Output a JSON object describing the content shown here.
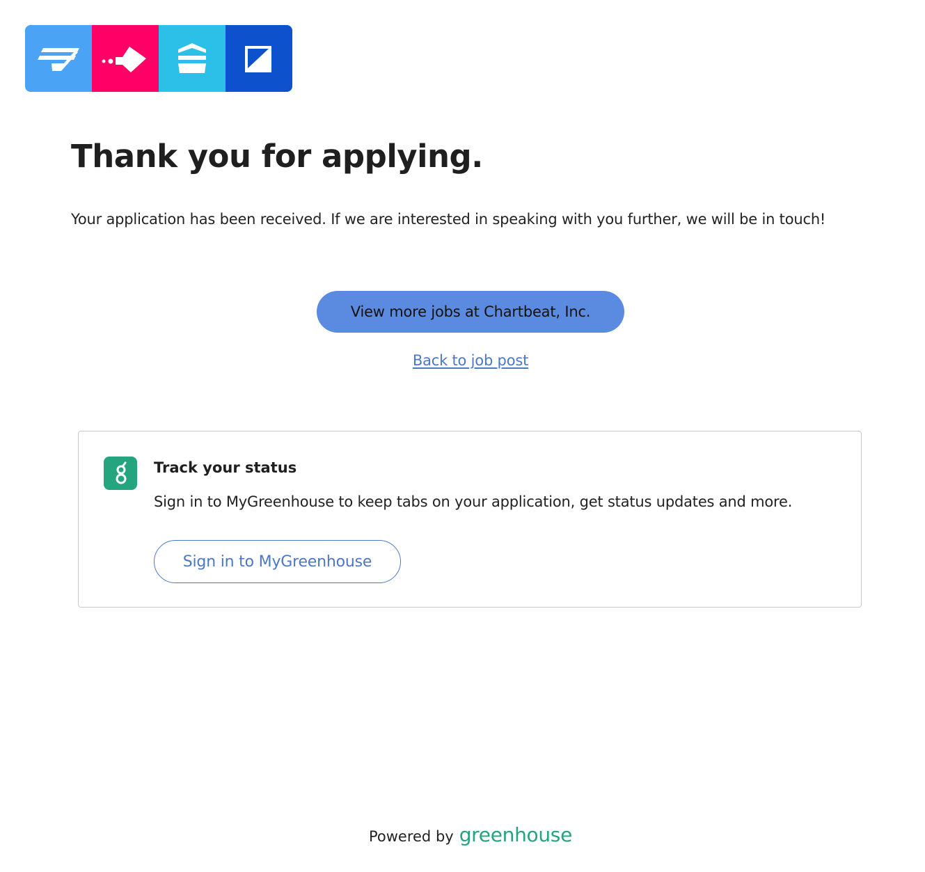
{
  "brand": {
    "logo_tiles": [
      {
        "icon": "speed-lines-icon",
        "color": "#4aa3f5"
      },
      {
        "icon": "arrow-fish-icon",
        "color": "#ff0066"
      },
      {
        "icon": "stacked-layers-icon",
        "color": "#2cc0e8"
      },
      {
        "icon": "diagonal-square-icon",
        "color": "#0d52cc"
      }
    ]
  },
  "confirmation": {
    "title": "Thank you for applying.",
    "message": "Your application has been received. If we are interested in speaking with you further, we will be in touch!"
  },
  "actions": {
    "view_more_jobs_label": "View more jobs at Chartbeat, Inc.",
    "back_link_label": "Back to job post"
  },
  "status_card": {
    "icon": "greenhouse-g-icon",
    "title": "Track your status",
    "description": "Sign in to MyGreenhouse to keep tabs on your application, get status updates and more.",
    "signin_button_label": "Sign in to MyGreenhouse"
  },
  "footer": {
    "powered_by": "Powered by",
    "wordmark": "greenhouse"
  },
  "colors": {
    "primary_button": "#5a8be0",
    "link": "#4a78c6",
    "greenhouse_green": "#24a47f"
  }
}
